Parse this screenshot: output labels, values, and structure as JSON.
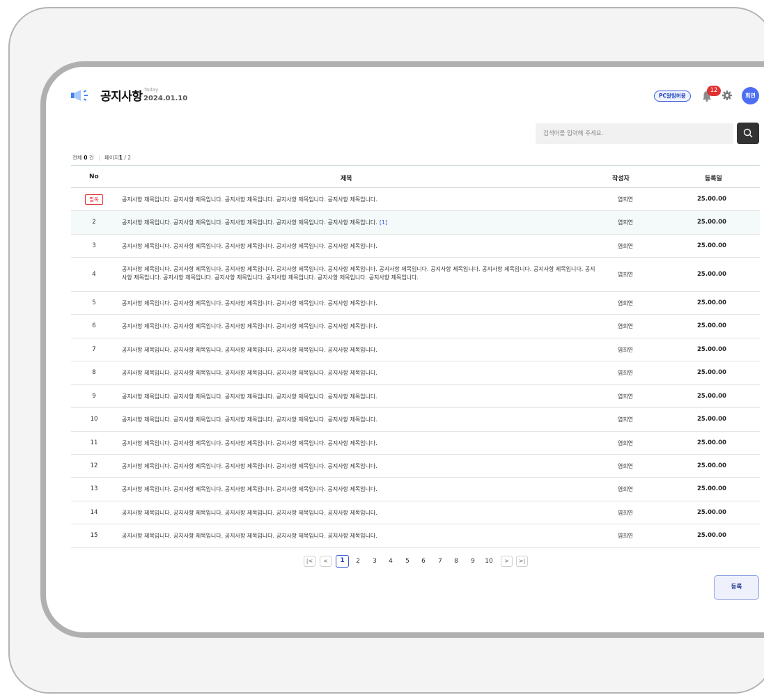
{
  "header": {
    "title": "공지사항",
    "today_label": "Today",
    "today_date": "2024.01.10",
    "pc_alarm_label": "PC알림허용",
    "notification_count": "12",
    "avatar_label": "회연"
  },
  "search": {
    "placeholder": "검색어를 입력해 주세요.",
    "value": ""
  },
  "summary": {
    "total_label": "전체",
    "total_count": "0",
    "total_unit": "건",
    "page_label": "페이지",
    "page_current": "1",
    "page_total": "/ 2"
  },
  "table": {
    "columns": {
      "no": "No",
      "title": "제목",
      "author": "작성자",
      "date": "등록일"
    },
    "rows": [
      {
        "no": "필독",
        "title": "공지사항 제목입니다. 공지사항 제목입니다. 공지사항 제목입니다. 공지사항 제목입니다. 공지사항 제목입니다.",
        "comments": "",
        "author": "염희연",
        "date": "25.00.00"
      },
      {
        "no": "2",
        "title": "공지사항 제목입니다. 공지사항 제목입니다. 공지사항 제목입니다. 공지사항 제목입니다. 공지사항 제목입니다.",
        "comments": "[1]",
        "author": "염희연",
        "date": "25.00.00"
      },
      {
        "no": "3",
        "title": "공지사항 제목입니다. 공지사항 제목입니다. 공지사항 제목입니다. 공지사항 제목입니다. 공지사항 제목입니다.",
        "comments": "",
        "author": "염희연",
        "date": "25.00.00"
      },
      {
        "no": "4",
        "title": "공지사항 제목입니다. 공지사항 제목입니다. 공지사항 제목입니다. 공지사항 제목입니다. 공지사항 제목입니다. 공지사항 제목입니다. 공지사항 제목입니다. 공지사항 제목입니다. 공지사항 제목입니다. 공지사항 제목입니다. 공지사항 제목입니다. 공지사항 제목입니다. 공지사항 제목입니다. 공지사항 제목입니다. 공지사항 제목입니다.",
        "comments": "",
        "author": "염희연",
        "date": "25.00.00"
      },
      {
        "no": "5",
        "title": "공지사항 제목입니다. 공지사항 제목입니다. 공지사항 제목입니다. 공지사항 제목입니다. 공지사항 제목입니다.",
        "comments": "",
        "author": "염희연",
        "date": "25.00.00"
      },
      {
        "no": "6",
        "title": "공지사항 제목입니다. 공지사항 제목입니다. 공지사항 제목입니다. 공지사항 제목입니다. 공지사항 제목입니다.",
        "comments": "",
        "author": "염희연",
        "date": "25.00.00"
      },
      {
        "no": "7",
        "title": "공지사항 제목입니다. 공지사항 제목입니다. 공지사항 제목입니다. 공지사항 제목입니다. 공지사항 제목입니다.",
        "comments": "",
        "author": "염희연",
        "date": "25.00.00"
      },
      {
        "no": "8",
        "title": "공지사항 제목입니다. 공지사항 제목입니다. 공지사항 제목입니다. 공지사항 제목입니다. 공지사항 제목입니다.",
        "comments": "",
        "author": "염희연",
        "date": "25.00.00"
      },
      {
        "no": "9",
        "title": "공지사항 제목입니다. 공지사항 제목입니다. 공지사항 제목입니다. 공지사항 제목입니다. 공지사항 제목입니다.",
        "comments": "",
        "author": "염희연",
        "date": "25.00.00"
      },
      {
        "no": "10",
        "title": "공지사항 제목입니다. 공지사항 제목입니다. 공지사항 제목입니다. 공지사항 제목입니다. 공지사항 제목입니다.",
        "comments": "",
        "author": "염희연",
        "date": "25.00.00"
      },
      {
        "no": "11",
        "title": "공지사항 제목입니다. 공지사항 제목입니다. 공지사항 제목입니다. 공지사항 제목입니다. 공지사항 제목입니다.",
        "comments": "",
        "author": "염희연",
        "date": "25.00.00"
      },
      {
        "no": "12",
        "title": "공지사항 제목입니다. 공지사항 제목입니다. 공지사항 제목입니다. 공지사항 제목입니다. 공지사항 제목입니다.",
        "comments": "",
        "author": "염희연",
        "date": "25.00.00"
      },
      {
        "no": "13",
        "title": "공지사항 제목입니다. 공지사항 제목입니다. 공지사항 제목입니다. 공지사항 제목입니다. 공지사항 제목입니다.",
        "comments": "",
        "author": "염희연",
        "date": "25.00.00"
      },
      {
        "no": "14",
        "title": "공지사항 제목입니다. 공지사항 제목입니다. 공지사항 제목입니다. 공지사항 제목입니다. 공지사항 제목입니다.",
        "comments": "",
        "author": "염희연",
        "date": "25.00.00"
      },
      {
        "no": "15",
        "title": "공지사항 제목입니다. 공지사항 제목입니다. 공지사항 제목입니다. 공지사항 제목입니다. 공지사항 제목입니다.",
        "comments": "",
        "author": "염희연",
        "date": "25.00.00"
      }
    ]
  },
  "pagination": {
    "first": "|<",
    "prev": "<",
    "next": ">",
    "last": ">|",
    "current": "1",
    "pages": [
      "2",
      "3",
      "4",
      "5",
      "6",
      "7",
      "8",
      "9",
      "10"
    ]
  },
  "actions": {
    "register_label": "등록"
  },
  "colors": {
    "accent": "#3b5bdb",
    "pin": "#e03131",
    "badge": "#e03131",
    "avatar": "#4c6ef5",
    "row_highlight": "#f4f9f9"
  },
  "icons": {
    "megaphone": "megaphone-icon",
    "bell": "bell-icon",
    "gear": "gear-icon",
    "search": "search-icon"
  }
}
